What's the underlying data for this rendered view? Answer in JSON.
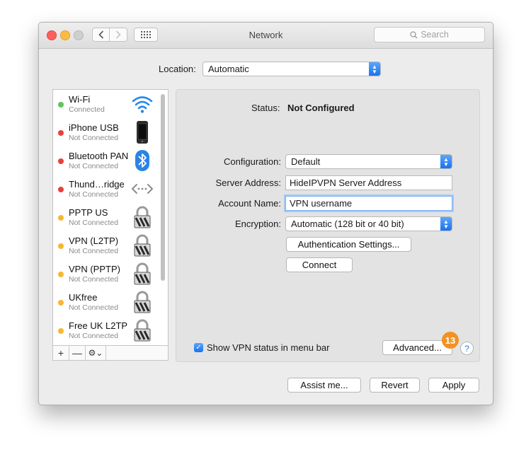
{
  "window": {
    "title": "Network",
    "search_placeholder": "Search"
  },
  "location": {
    "label": "Location:",
    "value": "Automatic"
  },
  "services": [
    {
      "name": "Wi-Fi",
      "status": "Connected",
      "dot": "green",
      "icon": "wifi-icon"
    },
    {
      "name": "iPhone USB",
      "status": "Not Connected",
      "dot": "red",
      "icon": "iphone-icon"
    },
    {
      "name": "Bluetooth PAN",
      "status": "Not Connected",
      "dot": "red",
      "icon": "bluetooth-icon"
    },
    {
      "name": "Thund…ridge",
      "status": "Not Connected",
      "dot": "red",
      "icon": "thunderbolt-bridge-icon"
    },
    {
      "name": "PPTP US",
      "status": "Not Connected",
      "dot": "yellow",
      "icon": "vpn-lock-icon"
    },
    {
      "name": "VPN (L2TP)",
      "status": "Not Connected",
      "dot": "yellow",
      "icon": "vpn-lock-icon"
    },
    {
      "name": "VPN (PPTP)",
      "status": "Not Connected",
      "dot": "yellow",
      "icon": "vpn-lock-icon"
    },
    {
      "name": "UKfree",
      "status": "Not Connected",
      "dot": "yellow",
      "icon": "vpn-lock-icon"
    },
    {
      "name": "Free UK L2TP",
      "status": "Not Connected",
      "dot": "yellow",
      "icon": "vpn-lock-icon"
    }
  ],
  "sidebar_footer": {
    "add": "+",
    "remove": "—",
    "gear": "⚙⌄"
  },
  "panel": {
    "status_label": "Status:",
    "status_value": "Not Configured",
    "configuration_label": "Configuration:",
    "configuration_value": "Default",
    "server_label": "Server Address:",
    "server_value": "HideIPVPN Server Address",
    "account_label": "Account Name:",
    "account_value": "VPN username",
    "encryption_label": "Encryption:",
    "encryption_value": "Automatic (128 bit or 40 bit)",
    "auth_button": "Authentication Settings...",
    "connect_button": "Connect",
    "show_status_label": "Show VPN status in menu bar",
    "show_status_checked": true,
    "advanced_button": "Advanced...",
    "badge": "13",
    "help": "?"
  },
  "footer": {
    "assist": "Assist me...",
    "revert": "Revert",
    "apply": "Apply"
  },
  "colors": {
    "accent": "#1a72ef",
    "badge": "#f29222",
    "dot_green": "#5fc55a",
    "dot_red": "#e9403a",
    "dot_yellow": "#f7b731"
  }
}
